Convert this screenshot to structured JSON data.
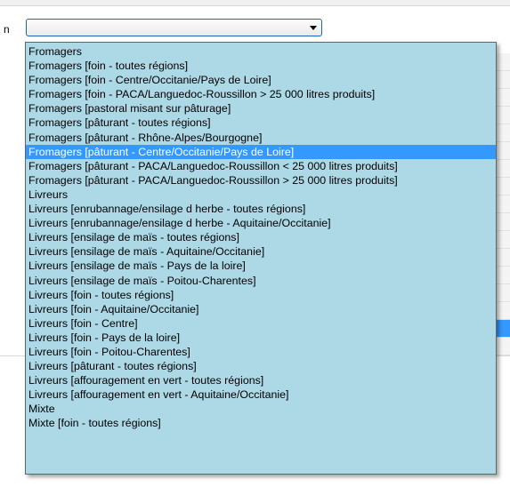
{
  "label_fragment": "n",
  "combo": {
    "value": ""
  },
  "colors": {
    "list_bg": "#add8e6",
    "selected_bg": "#3399ff",
    "selected_fg": "#ffffff",
    "combo_border": "#1c63b7"
  },
  "selected_index": 7,
  "options": [
    "Fromagers",
    "Fromagers [foin - toutes régions]",
    "Fromagers [foin - Centre/Occitanie/Pays de Loire]",
    "Fromagers [foin - PACA/Languedoc-Roussillon > 25 000 litres produits]",
    "Fromagers [pastoral misant sur pâturage]",
    "Fromagers [pâturant - toutes régions]",
    "Fromagers [pâturant - Rhône-Alpes/Bourgogne]",
    "Fromagers [pâturant - Centre/Occitanie/Pays de Loire]",
    "Fromagers [pâturant - PACA/Languedoc-Roussillon < 25 000 litres produits]",
    "Fromagers [pâturant - PACA/Languedoc-Roussillon > 25 000 litres produits]",
    "Livreurs",
    "Livreurs [enrubannage/ensilage d herbe - toutes régions]",
    "Livreurs [enrubannage/ensilage d herbe - Aquitaine/Occitanie]",
    "Livreurs [ensilage de maïs - toutes régions]",
    "Livreurs [ensilage de maïs - Aquitaine/Occitanie]",
    "Livreurs [ensilage de maïs - Pays de la loire]",
    "Livreurs [ensilage de maïs - Poitou-Charentes]",
    "Livreurs [foin - toutes régions]",
    "Livreurs [foin - Aquitaine/Occitanie]",
    "Livreurs [foin - Centre]",
    "Livreurs [foin - Pays de la loire]",
    "Livreurs [foin - Poitou-Charentes]",
    "Livreurs [pâturant - toutes régions]",
    "Livreurs [affouragement en vert - toutes régions]",
    "Livreurs [affouragement en vert - Aquitaine/Occitanie]",
    "Mixte",
    "Mixte [foin - toutes régions]"
  ]
}
